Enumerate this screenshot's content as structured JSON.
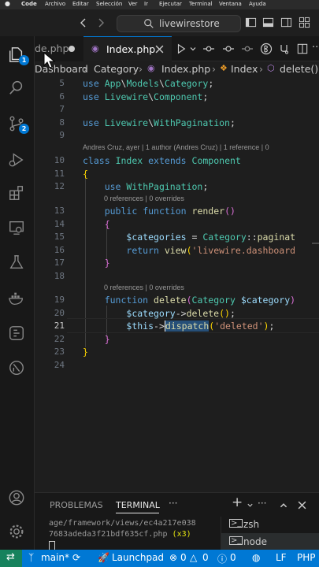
{
  "menubar": {
    "apple_icon": "apple-logo-icon",
    "items": [
      "Code",
      "Archivo",
      "Editar",
      "Selección",
      "Ver",
      "Ir",
      "Ejecutar",
      "Terminal",
      "Ventana",
      "Ayuda"
    ]
  },
  "titlebar": {
    "search_text": "livewirestore"
  },
  "activity": {
    "explorer_badge": "1",
    "scm_badge": "2"
  },
  "tabs": [
    {
      "label": "de.php",
      "modified": true
    },
    {
      "label": "Index.php",
      "active": true
    }
  ],
  "breadcrumb": {
    "items": [
      "Dashboard",
      "Category",
      "Index.php",
      "Index",
      "delete()"
    ]
  },
  "editor": {
    "lines": [
      {
        "n": "5",
        "text": "use App\\Models\\Category;"
      },
      {
        "n": "6",
        "text": "use Livewire\\Component;"
      },
      {
        "n": "7",
        "text": ""
      },
      {
        "n": "8",
        "text": "use Livewire\\WithPagination;"
      },
      {
        "n": "9",
        "text": ""
      },
      {
        "n": "10",
        "text": "class Index extends Component"
      },
      {
        "n": "11",
        "text": "{"
      },
      {
        "n": "12",
        "text": "use WithPagination;"
      },
      {
        "n": "13",
        "text": "public function render()"
      },
      {
        "n": "14",
        "text": "{"
      },
      {
        "n": "15",
        "text": "$categories = Category::paginat"
      },
      {
        "n": "16",
        "text": "return view('livewire.dashboard"
      },
      {
        "n": "17",
        "text": "}"
      },
      {
        "n": "18",
        "text": ""
      },
      {
        "n": "19",
        "text": "function delete(Category $category)"
      },
      {
        "n": "20",
        "text": "$category->delete();"
      },
      {
        "n": "21",
        "text": "$this->dispatch('deleted');"
      },
      {
        "n": "22",
        "text": "}"
      },
      {
        "n": "23",
        "text": "}"
      },
      {
        "n": "24",
        "text": ""
      }
    ],
    "codelens": {
      "blame": "Andres Cruz, ayer | 1 author (Andres Cruz) | 1 reference | 0",
      "refs1": "0 references | 0 overrides",
      "refs2": "0 references | 0 overrides",
      "refs3": "0 references | 0 overrides"
    }
  },
  "panel": {
    "tabs": [
      "PROBLEMAS",
      "TERMINAL"
    ],
    "active_tab": "TERMINAL",
    "more": "···",
    "terminal_lines": [
      "age/framework/views/ec4a217e038",
      "7683adeda3f21bdf635cf.php",
      "(x3)"
    ],
    "terminals": [
      "zsh",
      "node"
    ]
  },
  "statusbar": {
    "branch": "main*",
    "launchpad": "Launchpad",
    "errors": "0",
    "warnings": "0",
    "info": "0",
    "eol": "LF",
    "language": "PHP"
  },
  "colors": {
    "accent": "#0078d4",
    "remote": "#16825d",
    "badge": "#0078d4"
  }
}
